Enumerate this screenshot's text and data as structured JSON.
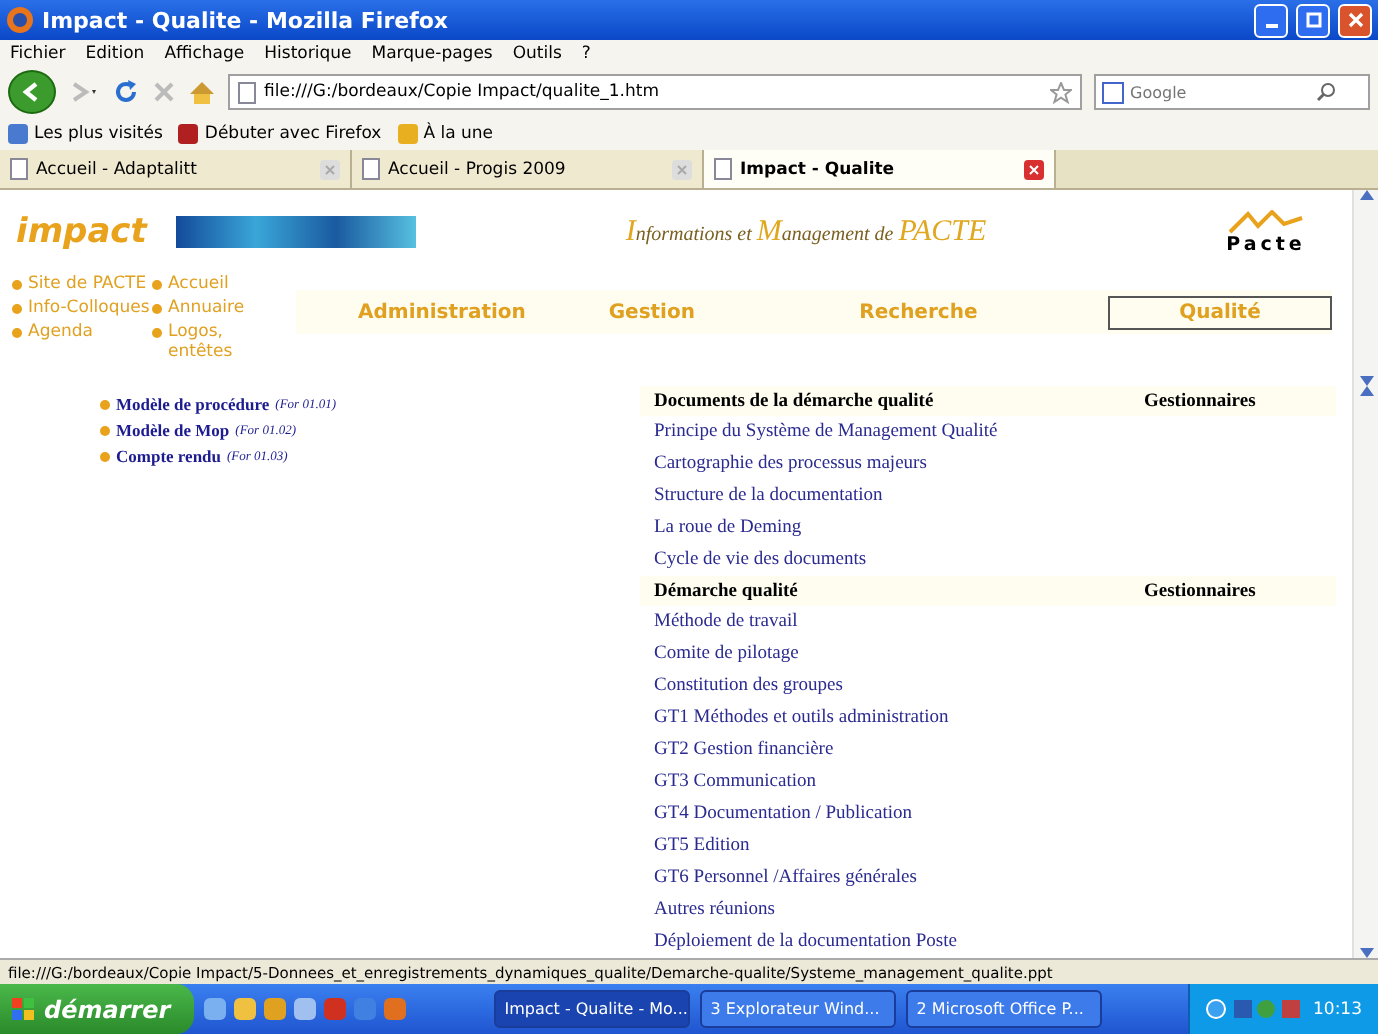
{
  "window": {
    "title": "Impact - Qualite - Mozilla Firefox"
  },
  "menu": [
    "Fichier",
    "Edition",
    "Affichage",
    "Historique",
    "Marque-pages",
    "Outils",
    "?"
  ],
  "address": {
    "value": "file:///G:/bordeaux/Copie Impact/qualite_1.htm"
  },
  "search": {
    "placeholder": "Google"
  },
  "bookmarks": [
    "Les plus visités",
    "Débuter avec Firefox",
    "À la une"
  ],
  "tabs": [
    {
      "label": "Accueil - Adaptalitt",
      "selected": false
    },
    {
      "label": "Accueil - Progis 2009",
      "selected": false
    },
    {
      "label": "Impact - Qualite",
      "selected": true
    }
  ],
  "page": {
    "logo": "impact",
    "heading": [
      {
        "text": "I",
        "kind": "cap"
      },
      {
        "text": "nformations et ",
        "kind": "small"
      },
      {
        "text": "M",
        "kind": "cap"
      },
      {
        "text": "anagement de ",
        "kind": "small"
      },
      {
        "text": "PACTE",
        "kind": "cap"
      }
    ],
    "brand": "Pacte",
    "quick_links": [
      "Site de PACTE",
      "Accueil",
      "Info-Colloques",
      "Annuaire",
      "Agenda",
      "Logos, entêtes"
    ],
    "nav": [
      {
        "label": "Administration",
        "selected": false
      },
      {
        "label": "Gestion",
        "selected": false
      },
      {
        "label": "Recherche",
        "selected": false
      },
      {
        "label": "Qualité",
        "selected": true
      }
    ],
    "side_links": [
      {
        "label": "Modèle de procédure",
        "ref": "(For 01.01)"
      },
      {
        "label": "Modèle de Mop",
        "ref": "(For 01.02)"
      },
      {
        "label": "Compte rendu",
        "ref": "(For 01.03)"
      }
    ],
    "sections": [
      {
        "title": "Documents de la démarche qualité",
        "column_2": "Gestionnaires",
        "items": [
          "Principe du Système de Management Qualité",
          "Cartographie des processus majeurs",
          "Structure de la documentation",
          "La roue de Deming",
          "Cycle de vie des documents"
        ]
      },
      {
        "title": "Démarche qualité",
        "column_2": "Gestionnaires",
        "items": [
          "Méthode de travail",
          "Comite de pilotage",
          "Constitution des groupes",
          "GT1 Méthodes et outils administration",
          "GT2 Gestion financière",
          "GT3 Communication",
          "GT4 Documentation / Publication",
          "GT5 Edition",
          "GT6 Personnel /Affaires générales",
          "Autres réunions",
          "Déploiement de la documentation Poste"
        ]
      }
    ]
  },
  "status_bar": "file:///G:/bordeaux/Copie Impact/5-Donnees_et_enregistrements_dynamiques_qualite/Demarche-qualite/Systeme_management_qualite.ppt",
  "taskbar": {
    "start": "démarrer",
    "tasks": [
      "Impact - Qualite - Mo...",
      "3 Explorateur Wind...",
      "2 Microsoft Office P..."
    ],
    "clock": "10:13"
  }
}
